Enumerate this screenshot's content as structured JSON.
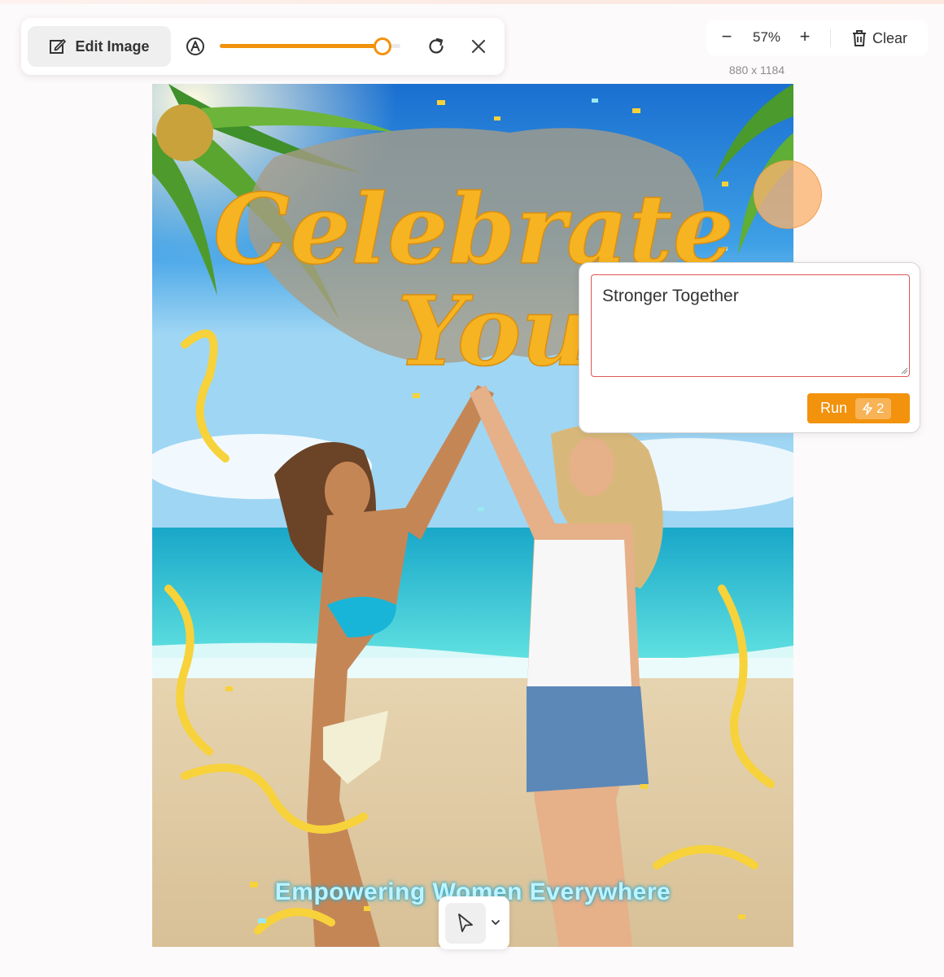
{
  "toolbar": {
    "edit_label": "Edit Image",
    "brush_size": 0.9
  },
  "zoom": {
    "out_symbol": "−",
    "value": "57%",
    "in_symbol": "+",
    "clear_label": "Clear"
  },
  "image": {
    "dimensions": "880 x 1184",
    "headline_line1": "Celebrate",
    "headline_line2": "You",
    "tagline": "Empowering Women Everywhere"
  },
  "prompt": {
    "value": "Stronger Together",
    "run_label": "Run",
    "credits": "2"
  },
  "icons": {
    "edit": "edit-square-icon",
    "brush": "brush-icon",
    "redo": "redo-icon",
    "close": "close-icon",
    "trash": "trash-icon",
    "lightning": "lightning-icon",
    "pointer": "pointer-icon",
    "chevron": "chevron-down-icon"
  },
  "colors": {
    "accent": "#f2920d",
    "input_border": "#e05656"
  }
}
